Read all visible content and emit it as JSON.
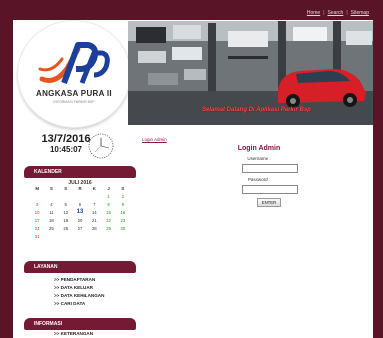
{
  "top_links": [
    "Home",
    "Search",
    "Sitemap"
  ],
  "logo": {
    "name": "ANGKASA PURA II",
    "tagline": "INFORMASI PARKIR BSP",
    "colors": {
      "blue": "#1c3f9a",
      "orange": "#e8531e"
    }
  },
  "banner": {
    "welcome_text": "Selamat Datang Di Aplikasi Parkir Bsp"
  },
  "clock": {
    "date": "13/7/2016",
    "time": "10:45:07"
  },
  "calendar": {
    "heading": "KALENDER",
    "month_title": "JULI 2016",
    "day_headers": [
      "M",
      "S",
      "S",
      "R",
      "K",
      "J",
      "S"
    ],
    "weeks": [
      [
        "",
        "",
        "",
        "",
        "",
        "1",
        "2"
      ],
      [
        "3",
        "4",
        "5",
        "6",
        "7",
        "8",
        "9"
      ],
      [
        "10",
        "11",
        "12",
        "13",
        "14",
        "15",
        "16"
      ],
      [
        "17",
        "18",
        "19",
        "20",
        "21",
        "22",
        "23"
      ],
      [
        "24",
        "25",
        "26",
        "27",
        "28",
        "29",
        "30"
      ],
      [
        "31",
        "",
        "",
        "",
        "",
        "",
        ""
      ]
    ],
    "today": "13"
  },
  "layanan": {
    "heading": "LAYANAN",
    "items": [
      ">> PENDAFTARAN",
      ">> DATA KELUAR",
      ">> DATA KEHILANGAN",
      ">> CARI DATA"
    ]
  },
  "informasi": {
    "heading": "INFORMASI",
    "items": [
      ">> KETERANGAN"
    ]
  },
  "main": {
    "login_admin_link": "Login Admin",
    "form_title": "Login Admin",
    "username_label": "Username :",
    "password_label": "Password :",
    "enter_button": "ENTER"
  },
  "colors": {
    "maroon": "#5a1427",
    "panel": "#741a35",
    "accent_red": "#ff4a4a"
  }
}
